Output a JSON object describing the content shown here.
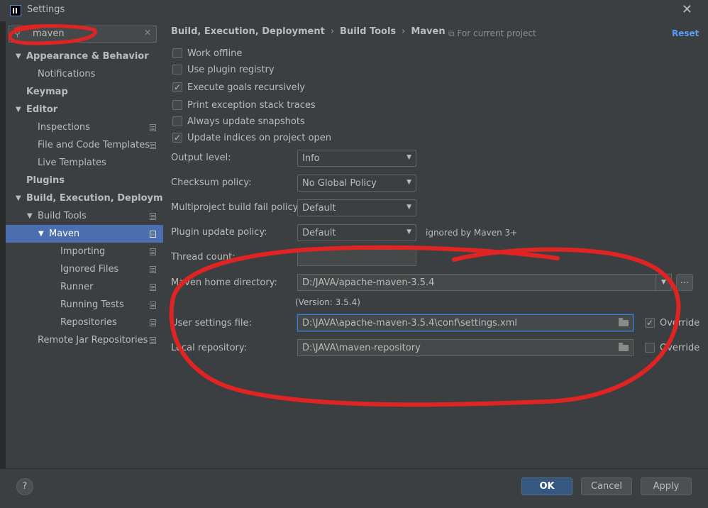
{
  "window": {
    "title": "Settings"
  },
  "search": {
    "value": "maven"
  },
  "sidebar": {
    "items": [
      {
        "label": "Appearance & Behavior",
        "bold": true
      },
      {
        "label": "Notifications"
      },
      {
        "label": "Keymap",
        "bold": true
      },
      {
        "label": "Editor",
        "bold": true
      },
      {
        "label": "Inspections"
      },
      {
        "label": "File and Code Templates"
      },
      {
        "label": "Live Templates"
      },
      {
        "label": "Plugins",
        "bold": true
      },
      {
        "label": "Build, Execution, Deployment",
        "bold": true
      },
      {
        "label": "Build Tools"
      },
      {
        "label": "Maven",
        "selected": true
      },
      {
        "label": "Importing"
      },
      {
        "label": "Ignored Files"
      },
      {
        "label": "Runner"
      },
      {
        "label": "Running Tests"
      },
      {
        "label": "Repositories"
      },
      {
        "label": "Remote Jar Repositories"
      }
    ]
  },
  "header": {
    "breadcrumb": [
      "Build, Execution, Deployment",
      "Build Tools",
      "Maven"
    ],
    "scope": "For current project",
    "reset": "Reset"
  },
  "options": [
    {
      "label": "Work offline",
      "checked": false
    },
    {
      "label": "Use plugin registry",
      "checked": false
    },
    {
      "label": "Execute goals recursively",
      "checked": true
    },
    {
      "label": "Print exception stack traces",
      "checked": false
    },
    {
      "label": "Always update snapshots",
      "checked": false
    },
    {
      "label": "Update indices on project open",
      "checked": true
    }
  ],
  "fields": {
    "output_level": {
      "label": "Output level:",
      "value": "Info"
    },
    "checksum_policy": {
      "label": "Checksum policy:",
      "value": "No Global Policy"
    },
    "fail_policy": {
      "label": "Multiproject build fail policy:",
      "value": "Default"
    },
    "plugin_update": {
      "label": "Plugin update policy:",
      "value": "Default",
      "note": "ignored by Maven 3+"
    },
    "thread_count": {
      "label": "Thread count:"
    },
    "maven_home": {
      "label": "Maven home directory:",
      "value": "D:/JAVA/apache-maven-3.5.4",
      "version": "(Version: 3.5.4)",
      "browse": "..."
    },
    "user_settings": {
      "label": "User settings file:",
      "value": "D:\\JAVA\\apache-maven-3.5.4\\conf\\settings.xml",
      "override_label": "Override",
      "override": true
    },
    "local_repo": {
      "label": "Local repository:",
      "value": "D:\\JAVA\\maven-repository",
      "override_label": "Override",
      "override": false
    }
  },
  "footer": {
    "help": "?",
    "ok": "OK",
    "cancel": "Cancel",
    "apply": "Apply"
  },
  "colors": {
    "annotation": "#e02424",
    "accent": "#589df6",
    "selection": "#4b6eaf"
  }
}
